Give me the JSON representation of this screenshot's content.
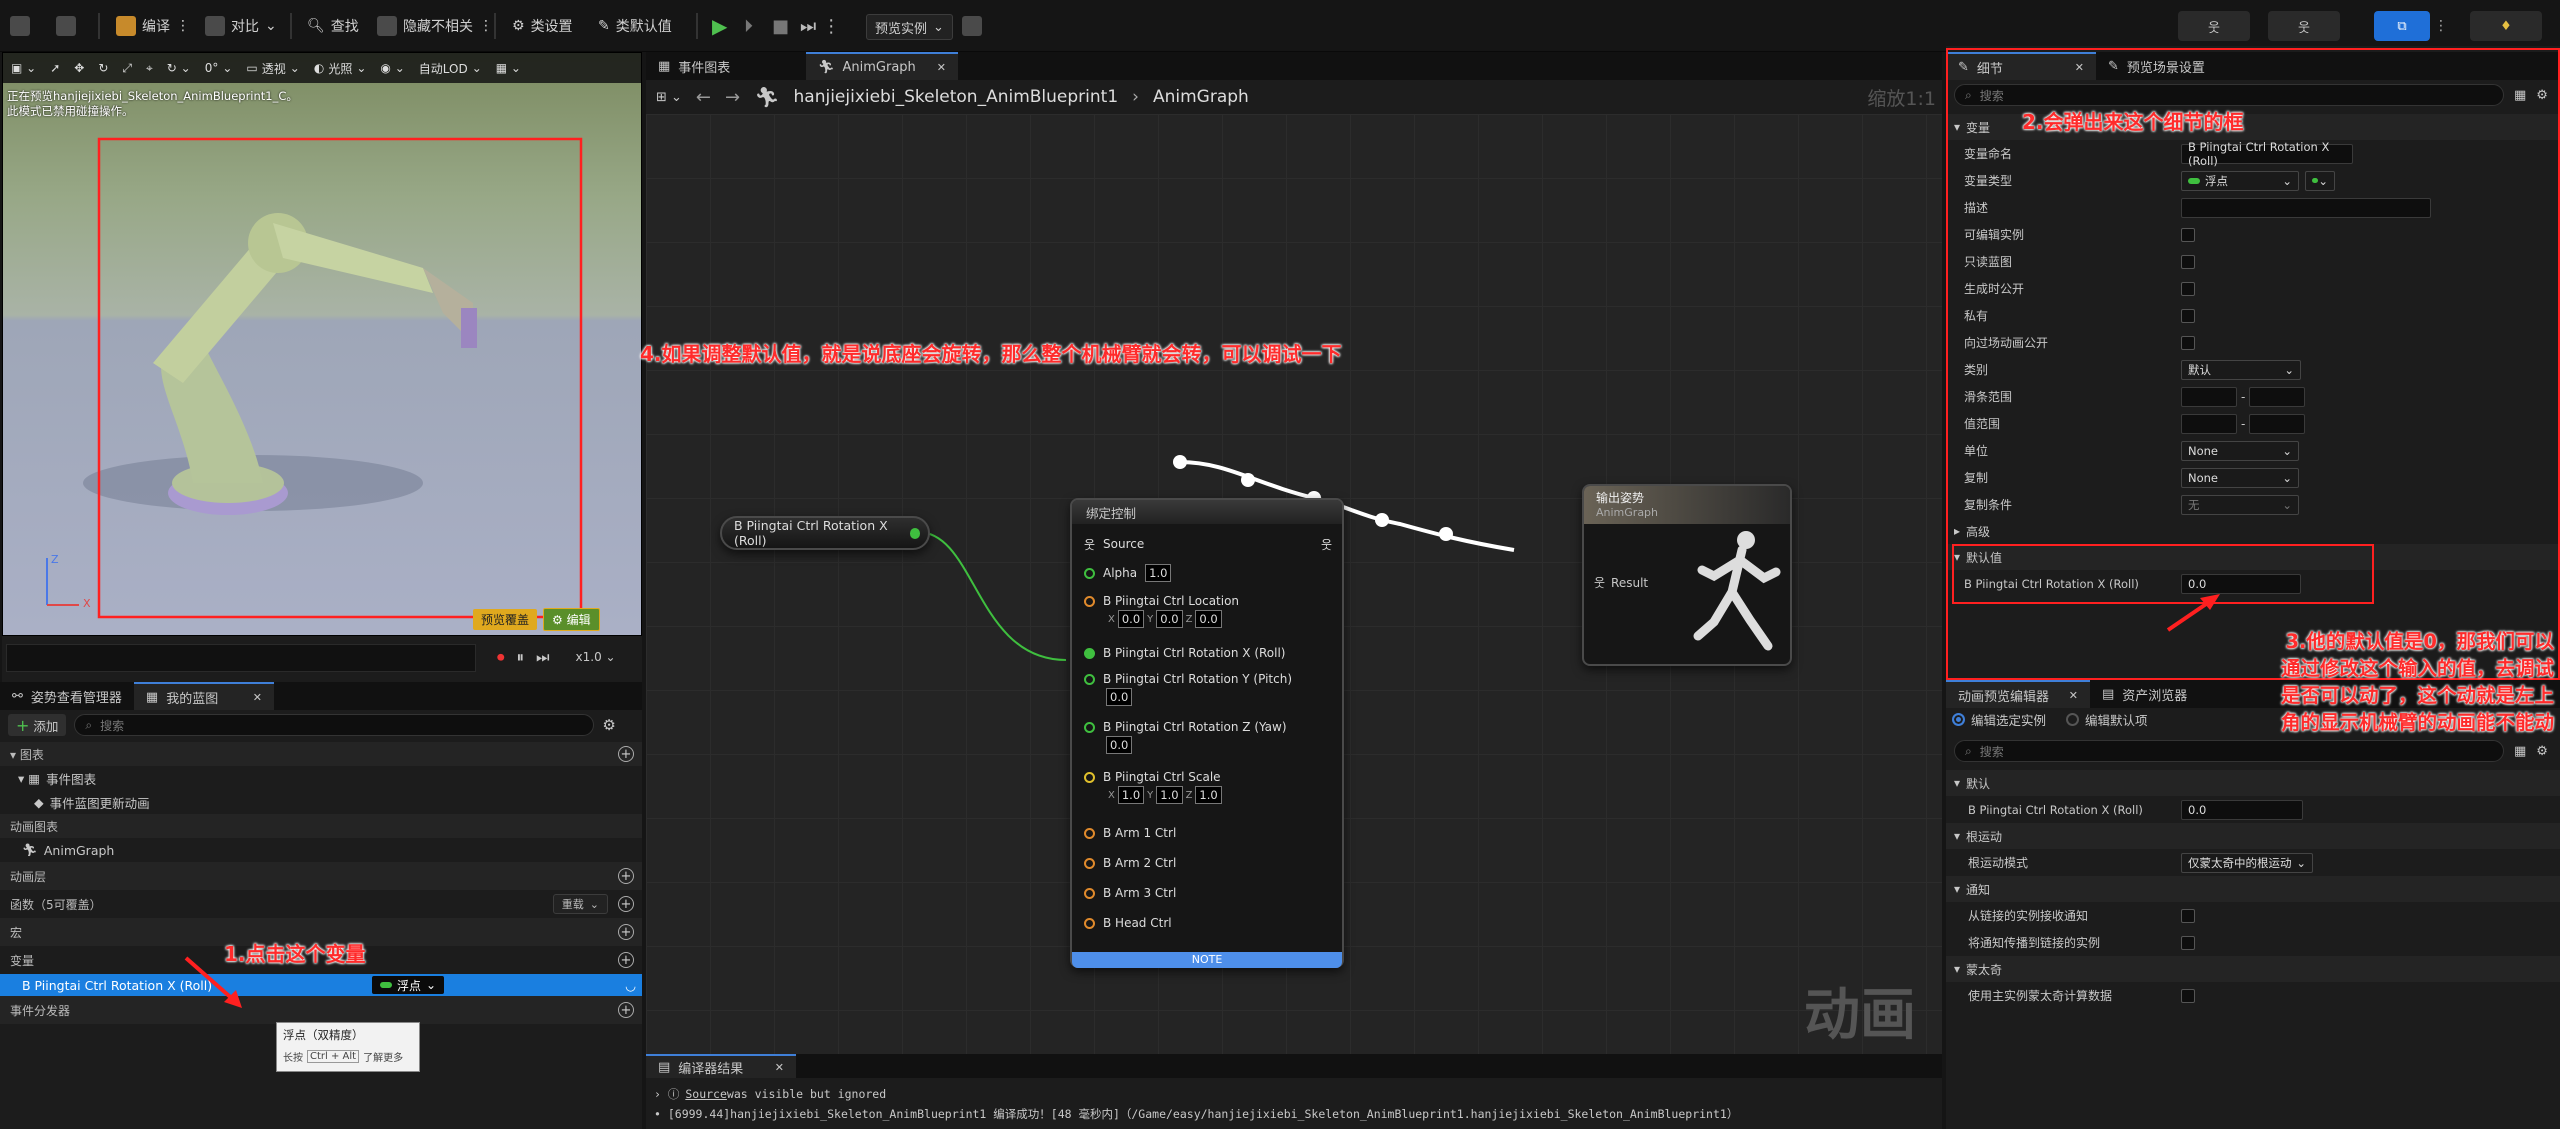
{
  "toolbar": {
    "compile": "编译",
    "diff": "对比",
    "find": "查找",
    "hide_unrelated": "隐藏不相关",
    "class_settings": "类设置",
    "class_defaults": "类默认值",
    "preview_instance": "预览实例"
  },
  "viewport": {
    "info_line1": "正在预览hanjiejixiebi_Skeleton_AnimBlueprint1_C。",
    "info_line2": "此模式已禁用碰撞操作。",
    "perspective": "透视",
    "lit": "光照",
    "lod": "自动LOD",
    "fov": "0°",
    "preview_override": "预览覆盖",
    "edit": "编辑",
    "speed": "x1.0",
    "axis_x": "X",
    "axis_z": "Z"
  },
  "left_tabs": {
    "pose_watch": "姿势查看管理器",
    "my_blueprint": "我的蓝图"
  },
  "my_blueprint": {
    "add": "添加",
    "search_placeholder": "搜索",
    "graphs": "图表",
    "event_graph": "事件图表",
    "event_update": "事件蓝图更新动画",
    "anim_graphs": "动画图表",
    "anim_graph": "AnimGraph",
    "anim_layers": "动画层",
    "functions": "函数（5可覆盖）",
    "override": "重载",
    "macros": "宏",
    "variables": "变量",
    "variable_name": "B Piingtai Ctrl Rotation X (Roll)",
    "variable_type": "浮点",
    "dispatchers": "事件分发器",
    "tooltip_title": "浮点（双精度）",
    "tooltip_hold": "长按",
    "tooltip_key": "Ctrl + Alt",
    "tooltip_more": "了解更多"
  },
  "graph_tabs": {
    "event_graph": "事件图表",
    "anim_graph": "AnimGraph"
  },
  "breadcrumb": {
    "blueprint": "hanjiejixiebi_Skeleton_AnimBlueprint1",
    "graph": "AnimGraph",
    "zoom": "缩放1:1"
  },
  "nodes": {
    "var_getter": "B Piingtai Ctrl Rotation X (Roll)",
    "control_rig": {
      "title": "绑定控制",
      "source": "Source",
      "alpha": "Alpha",
      "alpha_val": "1.0",
      "location": "B Piingtai Ctrl Location",
      "loc_x": "0.0",
      "loc_y": "0.0",
      "loc_z": "0.0",
      "rot_x": "B Piingtai Ctrl Rotation X (Roll)",
      "rot_y": "B Piingtai Ctrl Rotation Y (Pitch)",
      "rot_y_val": "0.0",
      "rot_z": "B Piingtai Ctrl Rotation Z (Yaw)",
      "rot_z_val": "0.0",
      "scale": "B Piingtai Ctrl Scale",
      "sc_x": "1.0",
      "sc_y": "1.0",
      "sc_z": "1.0",
      "arm1": "B Arm 1 Ctrl",
      "arm2": "B Arm 2 Ctrl",
      "arm3": "B Arm 3 Ctrl",
      "head": "B Head Ctrl",
      "note": "NOTE"
    },
    "output_pose": {
      "title": "输出姿势",
      "subtitle": "AnimGraph",
      "result": "Result"
    }
  },
  "watermark": "动画",
  "compiler": {
    "tab": "编译器结果",
    "line1_link": "Source",
    "line1_text": " was visible but ignored",
    "line2": "[6999.44]hanjiejixiebi_Skeleton_AnimBlueprint1 编译成功！[48 毫秒内]（/Game/easy/hanjiejixiebi_Skeleton_AnimBlueprint1.hanjiejixiebi_Skeleton_AnimBlueprint1）"
  },
  "details": {
    "tab_details": "细节",
    "tab_scene": "预览场景设置",
    "search_placeholder": "搜索",
    "sec_variable": "变量",
    "var_name_label": "变量命名",
    "var_name": "B Piingtai Ctrl Rotation X (Roll)",
    "var_type_label": "变量类型",
    "var_type": "浮点",
    "desc_label": "描述",
    "instance_editable": "可编辑实例",
    "readonly": "只读蓝图",
    "expose_spawn": "生成时公开",
    "private": "私有",
    "expose_cine": "向过场动画公开",
    "category_label": "类别",
    "category": "默认",
    "slider_range": "滑条范围",
    "value_range": "值范围",
    "units_label": "单位",
    "units": "None",
    "replication_label": "复制",
    "replication": "None",
    "rep_condition_label": "复制条件",
    "rep_condition": "无",
    "advanced": "高级",
    "sec_default": "默认值",
    "default_label": "B Piingtai Ctrl Rotation X (Roll)",
    "default_value": "0.0"
  },
  "preview_editor": {
    "tab1": "动画预览编辑器",
    "tab2": "资产浏览器",
    "radio1": "编辑选定实例",
    "radio2": "编辑默认项",
    "search_placeholder": "搜索",
    "sec_default": "默认",
    "var_label": "B Piingtai Ctrl Rotation X (Roll)",
    "var_value": "0.0",
    "sec_root": "根运动",
    "root_mode_label": "根运动模式",
    "root_mode": "仅蒙太奇中的根运动",
    "sec_notify": "通知",
    "notify1": "从链接的实例接收通知",
    "notify2": "将通知传播到链接的实例",
    "sec_montage": "蒙太奇",
    "montage1": "使用主实例蒙太奇计算数据"
  },
  "annotations": {
    "a1": "1.点击这个变量",
    "a2": "2.会弹出来这个细节的框",
    "a3_l1": "3.他的默认值是0，那我们可以",
    "a3_l2": "通过修改这个输入的值，去调试",
    "a3_l3": "是否可以动了，这个动就是左上",
    "a3_l4": "角的显示机械臂的动画能不能动",
    "a4": "4.如果调整默认值，就是说底座会旋转，那么整个机械臂就会转，可以调试一下"
  },
  "colors": {
    "accent": "#3f7fd8",
    "annotation": "#ff2b2b",
    "float_pin": "#3fbf3f",
    "struct_pin": "#e08a2c",
    "selected_row": "#1a7fe0"
  }
}
